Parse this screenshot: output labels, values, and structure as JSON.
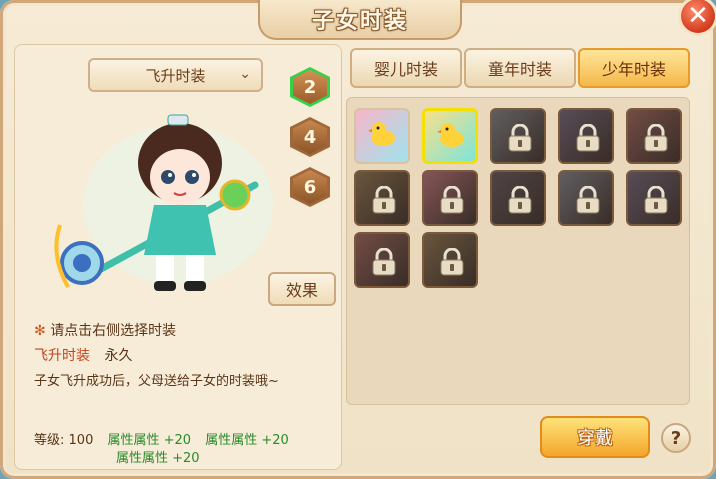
{
  "window": {
    "title": "子女时装"
  },
  "close_icon": "close-icon",
  "dropdown": {
    "selected": "飞升时装"
  },
  "stage_buttons": [
    "2",
    "4",
    "6"
  ],
  "effect_button": "效果",
  "hint": {
    "star": "✻",
    "text": "请点击右侧选择时装"
  },
  "outfit": {
    "name": "飞升时装",
    "duration": "永久",
    "description": "子女飞升成功后，父母送给子女的时装哦~"
  },
  "stats": {
    "level_label": "等级:",
    "level_value": "100",
    "lines": [
      "属性属性 +20",
      "属性属性 +20",
      "属性属性 +20"
    ]
  },
  "tabs": [
    "婴儿时装",
    "童年时装",
    "少年时装"
  ],
  "active_tab": "少年时装",
  "slots": [
    {
      "state": "owned"
    },
    {
      "state": "selected"
    },
    {
      "state": "locked"
    },
    {
      "state": "locked"
    },
    {
      "state": "locked"
    },
    {
      "state": "locked"
    },
    {
      "state": "locked"
    },
    {
      "state": "locked"
    },
    {
      "state": "locked"
    },
    {
      "state": "locked"
    },
    {
      "state": "locked"
    },
    {
      "state": "locked"
    }
  ],
  "wear_button": "穿戴",
  "help_button": "?",
  "colors": {
    "accent": "#f4b84a",
    "selected_border": "#f4e000",
    "hp_green": "#2a8a2a",
    "name_red": "#c4431a"
  }
}
